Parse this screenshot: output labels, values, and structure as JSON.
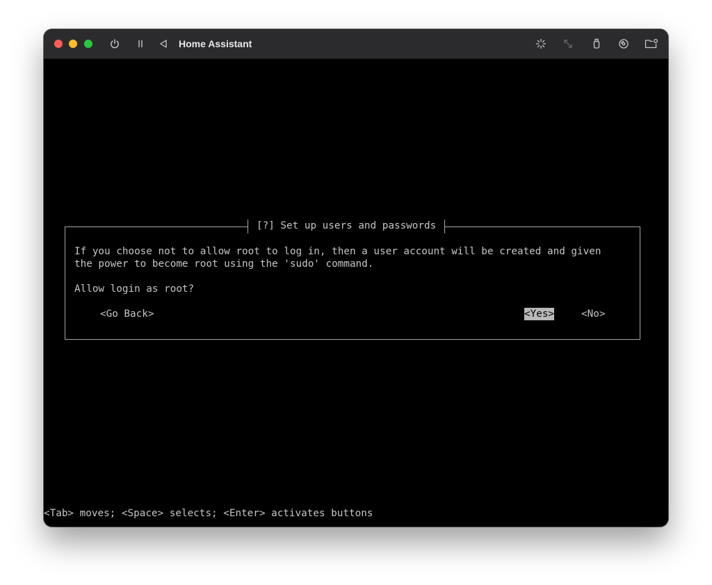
{
  "window": {
    "title": "Home Assistant",
    "controls": {
      "close_color": "#fe5f57",
      "minimize_color": "#febc2e",
      "zoom_color": "#28c840"
    },
    "toolbar_icons": [
      "power-icon",
      "pause-icon",
      "back-icon",
      "spinner-icon",
      "resize-icon",
      "usb-icon",
      "disc-icon",
      "folder-icon"
    ]
  },
  "dialog": {
    "title": "[?] Set up users and passwords",
    "message_line1": "If you choose not to allow root to log in, then a user account will be created and given",
    "message_line2": "the power to become root using the 'sudo' command.",
    "question": "Allow login as root?",
    "buttons": {
      "back": "<Go Back>",
      "yes": "<Yes>",
      "no": "<No>"
    },
    "selected_button": "yes"
  },
  "help_text": "<Tab> moves; <Space> selects; <Enter> activates buttons"
}
